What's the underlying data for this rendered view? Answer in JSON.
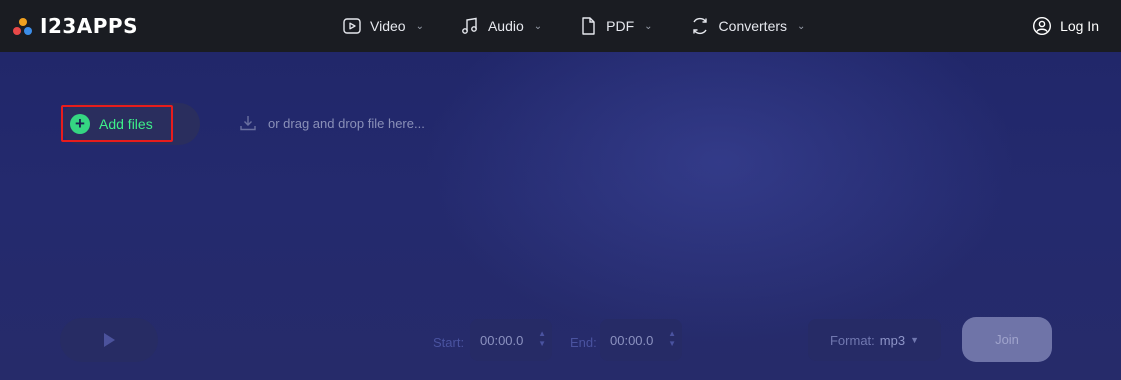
{
  "header": {
    "logo_text": "I23APPS",
    "nav": [
      {
        "label": "Video",
        "icon": "video-icon"
      },
      {
        "label": "Audio",
        "icon": "music-note-icon"
      },
      {
        "label": "PDF",
        "icon": "document-icon"
      },
      {
        "label": "Converters",
        "icon": "convert-icon"
      }
    ],
    "login_label": "Log In"
  },
  "upload": {
    "add_files_label": "Add files",
    "drop_hint": "or drag and drop file here..."
  },
  "controls": {
    "start_label": "Start:",
    "start_value": "00:00.0",
    "end_label": "End:",
    "end_value": "00:00.0",
    "format_label": "Format:",
    "format_value": "mp3",
    "join_label": "Join"
  },
  "colors": {
    "accent_green": "#3ef08a",
    "highlight_red": "#e81c1c",
    "topbar_bg": "#1a1c22"
  }
}
